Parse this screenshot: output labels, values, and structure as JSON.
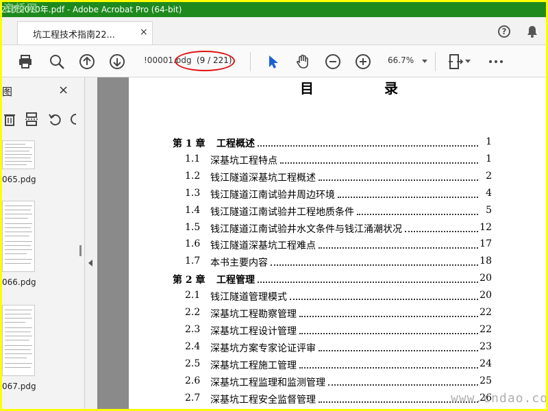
{
  "window": {
    "title": "21页2010年.pdf - Adobe Acrobat Pro (64-bit)",
    "watermark": "资桥网"
  },
  "tabs": [
    {
      "label": "坑工程技术指南22...",
      "close": "×"
    }
  ],
  "header_icons": {
    "help": "?",
    "notifications": "bell-icon"
  },
  "toolbar": {
    "filename": "!00001.pdg",
    "page_indicator": "(9 / 221)",
    "zoom": "66.7%"
  },
  "sidebar": {
    "title": "图",
    "close": "×",
    "thumbnails": [
      {
        "label": "065.pdg"
      },
      {
        "label": "066.pdg"
      },
      {
        "label": "067.pdg"
      }
    ]
  },
  "document": {
    "title": "目 录",
    "toc": [
      {
        "num": "第 1 章",
        "title": "工程概述",
        "page": "1",
        "chapter": true
      },
      {
        "num": "1.1",
        "title": "深基坑工程特点",
        "page": "1",
        "chapter": false
      },
      {
        "num": "1.2",
        "title": "钱江隧道深基坑工程概述",
        "page": "2",
        "chapter": false
      },
      {
        "num": "1.3",
        "title": "钱江隧道江南试验井周边环境",
        "page": "4",
        "chapter": false
      },
      {
        "num": "1.4",
        "title": "钱江隧道江南试验井工程地质条件",
        "page": "5",
        "chapter": false
      },
      {
        "num": "1.5",
        "title": "钱江隧道江南试验井水文条件与钱江涌潮状况",
        "page": "12",
        "chapter": false
      },
      {
        "num": "1.6",
        "title": "钱江隧道深基坑工程难点",
        "page": "17",
        "chapter": false
      },
      {
        "num": "1.7",
        "title": "本书主要内容",
        "page": "18",
        "chapter": false
      },
      {
        "num": "第 2 章",
        "title": "工程管理",
        "page": "20",
        "chapter": true
      },
      {
        "num": "2.1",
        "title": "钱江隧道管理模式",
        "page": "20",
        "chapter": false
      },
      {
        "num": "2.2",
        "title": "深基坑工程勘察管理",
        "page": "22",
        "chapter": false
      },
      {
        "num": "2.3",
        "title": "深基坑工程设计管理",
        "page": "22",
        "chapter": false
      },
      {
        "num": "2.4",
        "title": "深基坑方案专家论证评审",
        "page": "23",
        "chapter": false
      },
      {
        "num": "2.5",
        "title": "深基坑工程施工管理",
        "page": "24",
        "chapter": false
      },
      {
        "num": "2.6",
        "title": "深基坑工程监理和监测管理",
        "page": "25",
        "chapter": false
      },
      {
        "num": "2.7",
        "title": "深基坑工程安全监督管理",
        "page": "26",
        "chapter": false
      }
    ]
  },
  "footer_watermark": "www.cndao.com"
}
